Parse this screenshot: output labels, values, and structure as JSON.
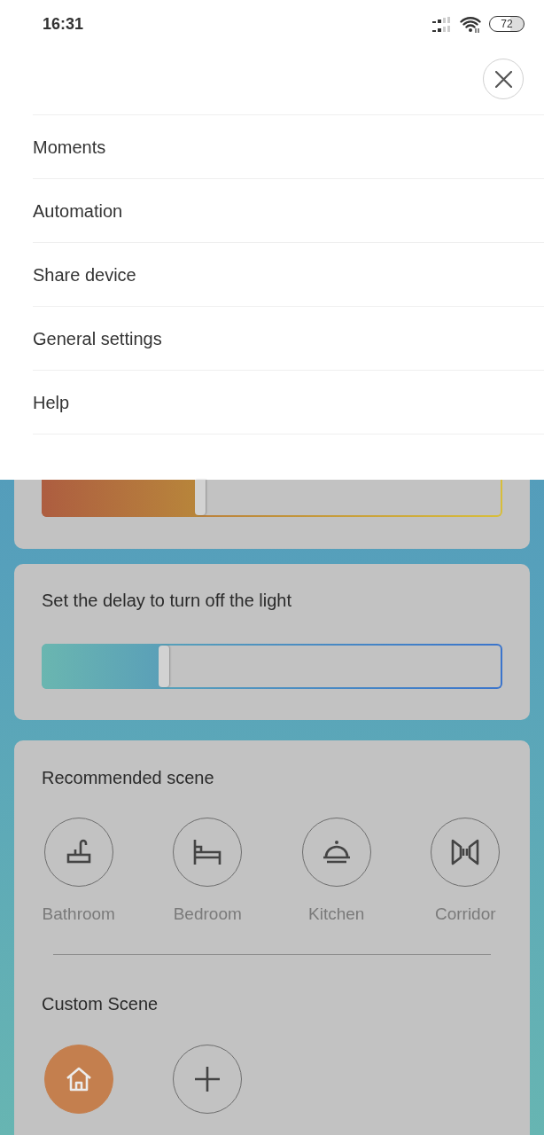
{
  "status_bar": {
    "time": "16:31",
    "battery": "72"
  },
  "menu": {
    "items": [
      {
        "label": "Moments"
      },
      {
        "label": "Automation"
      },
      {
        "label": "Share device"
      },
      {
        "label": "General settings"
      },
      {
        "label": "Help"
      }
    ]
  },
  "slider_cards": [
    {
      "kind": "warm",
      "level": 0.345
    },
    {
      "kind": "cool",
      "title": "Set the delay to turn off the light",
      "level": 0.266
    }
  ],
  "recommended_scene": {
    "title": "Recommended scene",
    "scenes": [
      {
        "label": "Bathroom"
      },
      {
        "label": "Bedroom"
      },
      {
        "label": "Kitchen"
      },
      {
        "label": "Corridor"
      }
    ]
  },
  "custom_scene": {
    "title": "Custom Scene",
    "items": [
      {
        "kind": "scene",
        "selected": true
      },
      {
        "kind": "add",
        "selected": false
      }
    ]
  }
}
